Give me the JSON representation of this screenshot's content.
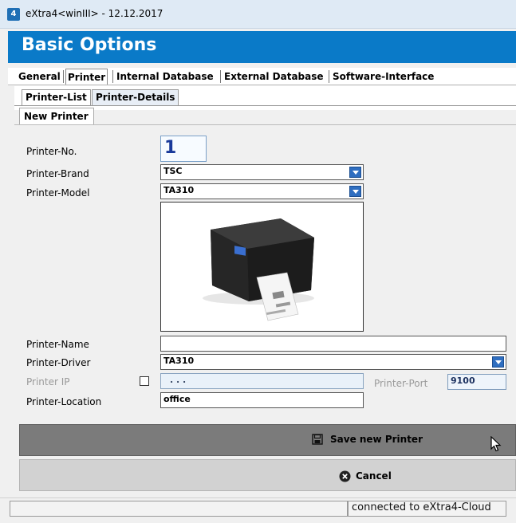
{
  "window": {
    "title": "eXtra4<winIII>  -  12.12.2017",
    "icon": "app-logo-icon"
  },
  "header": {
    "title": "Basic Options"
  },
  "main_tabs": [
    {
      "label": "General"
    },
    {
      "label": "Printer",
      "active": true
    },
    {
      "label": "Internal Database"
    },
    {
      "label": "External Database"
    },
    {
      "label": "Software-Interface"
    }
  ],
  "sub_tabs": [
    {
      "label": "Printer-List"
    },
    {
      "label": "Printer-Details",
      "active": true
    }
  ],
  "inner_tab": {
    "label": "New Printer"
  },
  "form": {
    "printer_no": {
      "label": "Printer-No.",
      "value": "1"
    },
    "printer_brand": {
      "label": "Printer-Brand",
      "value": "TSC"
    },
    "printer_model": {
      "label": "Printer-Model",
      "value": "TA310"
    },
    "printer_name": {
      "label": "Printer-Name",
      "value": ""
    },
    "printer_driver": {
      "label": "Printer-Driver",
      "value": "TA310"
    },
    "printer_ip": {
      "label": "Printer IP",
      "value": ". . .",
      "checked": false
    },
    "printer_port": {
      "label": "Printer-Port",
      "value": "9100"
    },
    "printer_location": {
      "label": "Printer-Location",
      "value": "office"
    }
  },
  "buttons": {
    "save": {
      "label": "Save new Printer",
      "icon": "floppy-disk-icon"
    },
    "cancel": {
      "label": "Cancel",
      "icon": "cancel-circle-icon"
    }
  },
  "status": {
    "connection": "connected to eXtra4-Cloud"
  },
  "colors": {
    "header_blue": "#0a7ac8",
    "dropdown_blue": "#2f6ec0",
    "printer_no_blue": "#1a3a9a"
  }
}
